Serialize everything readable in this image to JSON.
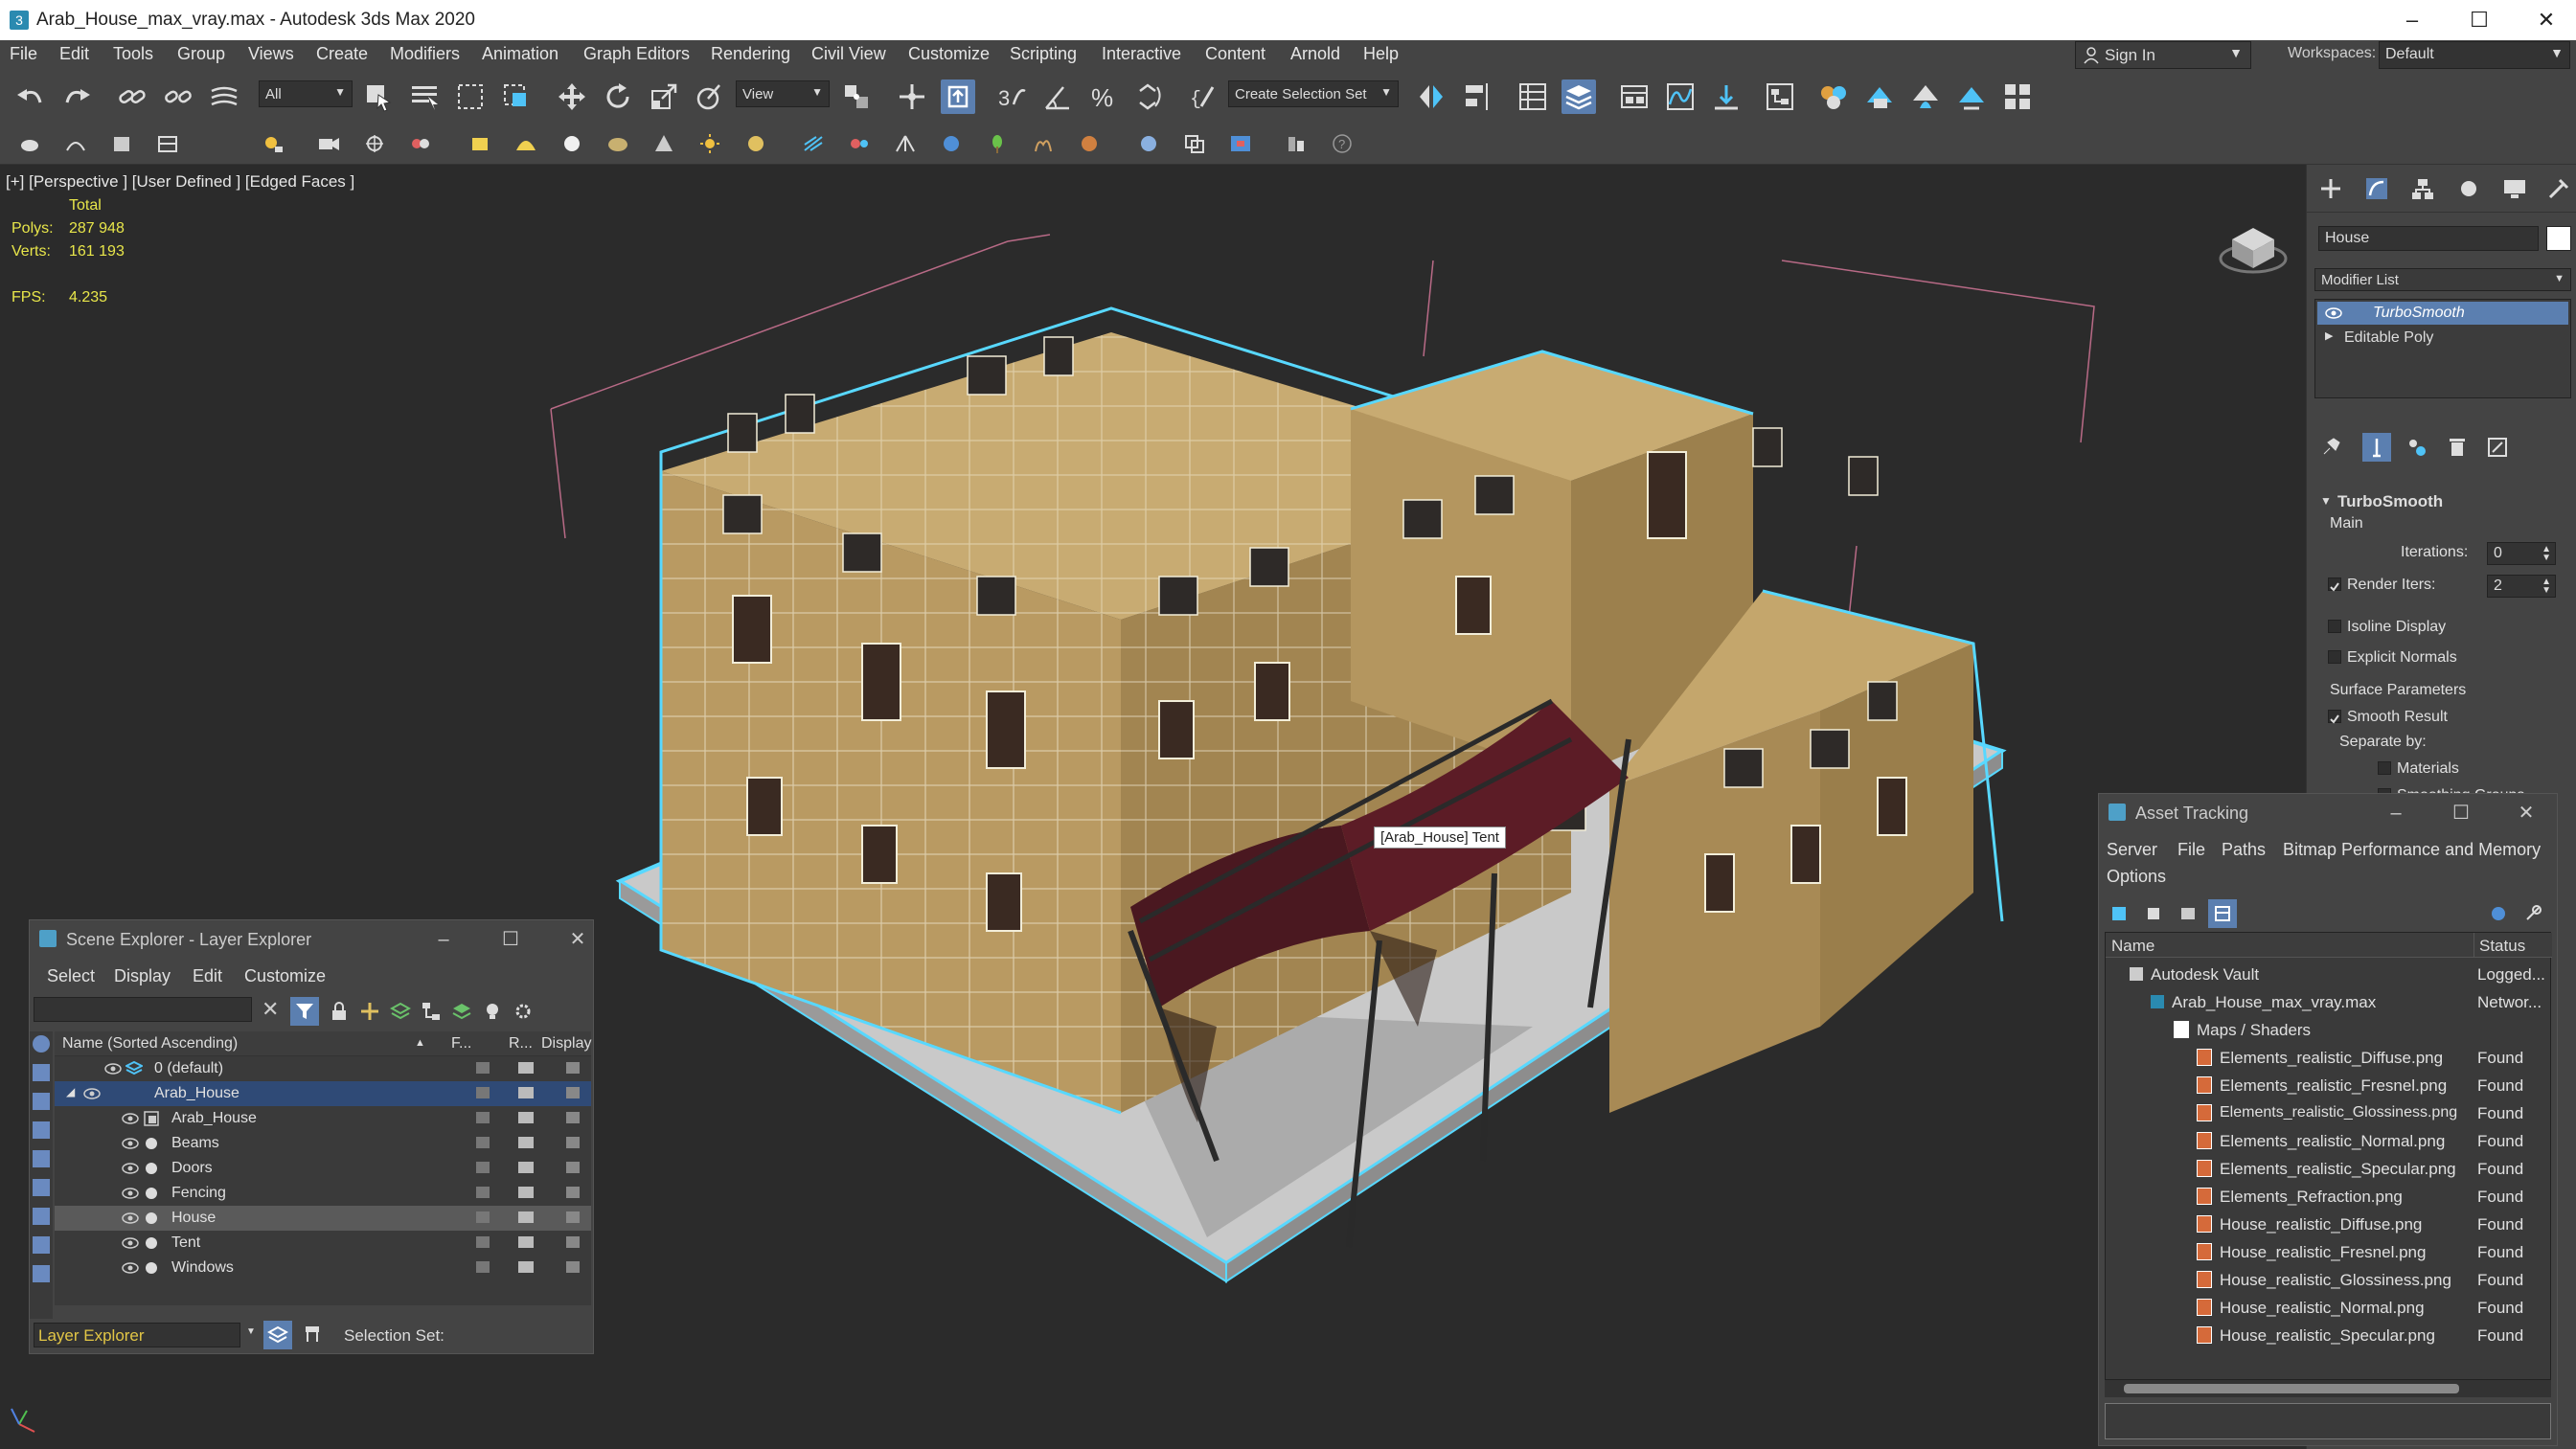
{
  "window": {
    "title": "Arab_House_max_vray.max - Autodesk 3ds Max 2020",
    "minimize": "–",
    "maximize": "☐",
    "close": "✕"
  },
  "menu": [
    "File",
    "Edit",
    "Tools",
    "Group",
    "Views",
    "Create",
    "Modifiers",
    "Animation",
    "Graph Editors",
    "Rendering",
    "Civil View",
    "Customize",
    "Scripting",
    "Interactive",
    "Content",
    "Arnold",
    "Help"
  ],
  "account": {
    "sign_in": "Sign In",
    "workspaces_label": "Workspaces:",
    "workspace": "Default"
  },
  "toolbar": {
    "selection_filter": "All",
    "ref_coord": "View",
    "selection_set": "Create Selection Set"
  },
  "viewport": {
    "label": "[+] [Perspective ] [User Defined ] [Edged Faces ]",
    "stats": {
      "total_label": "Total",
      "polys_label": "Polys:",
      "polys": "287 948",
      "verts_label": "Verts:",
      "verts": "161 193",
      "fps_label": "FPS:",
      "fps": "4.235"
    },
    "tooltip": "[Arab_House] Tent"
  },
  "command_panel": {
    "object_name": "House",
    "modifier_list": "Modifier List",
    "stack": [
      "TurboSmooth",
      "Editable Poly"
    ],
    "rollout_title": "TurboSmooth",
    "main_label": "Main",
    "iterations_label": "Iterations:",
    "iterations": "0",
    "render_iters_label": "Render Iters:",
    "render_iters": "2",
    "isoline_display": "Isoline Display",
    "explicit_normals": "Explicit Normals",
    "surface_params": "Surface Parameters",
    "smooth_result": "Smooth Result",
    "separate_by": "Separate by:",
    "materials": "Materials",
    "smoothing_groups": "Smoothing Groups"
  },
  "scene_explorer": {
    "title": "Scene Explorer - Layer Explorer",
    "menu": [
      "Select",
      "Display",
      "Edit",
      "Customize"
    ],
    "columns": {
      "name": "Name (Sorted Ascending)",
      "sort_arrow": "▲",
      "freeze": "F...",
      "render": "R...",
      "display": "Display ..."
    },
    "rows": [
      {
        "name": "0 (default)"
      },
      {
        "name": "Arab_House"
      },
      {
        "name": "Arab_House"
      },
      {
        "name": "Beams"
      },
      {
        "name": "Doors"
      },
      {
        "name": "Fencing"
      },
      {
        "name": "House"
      },
      {
        "name": "Tent"
      },
      {
        "name": "Windows"
      }
    ],
    "footer_explorer": "Layer Explorer",
    "selection_set_label": "Selection Set:"
  },
  "asset_tracking": {
    "title": "Asset Tracking",
    "menu": [
      "Server",
      "File",
      "Paths",
      "Bitmap Performance and Memory",
      "Options"
    ],
    "columns": {
      "name": "Name",
      "status": "Status"
    },
    "rows": [
      {
        "name": "Autodesk Vault",
        "status": "Logged..."
      },
      {
        "name": "Arab_House_max_vray.max",
        "status": "Networ..."
      },
      {
        "name": "Maps / Shaders",
        "status": ""
      },
      {
        "name": "Elements_realistic_Diffuse.png",
        "status": "Found"
      },
      {
        "name": "Elements_realistic_Fresnel.png",
        "status": "Found"
      },
      {
        "name": "Elements_realistic_Glossiness.png",
        "status": "Found"
      },
      {
        "name": "Elements_realistic_Normal.png",
        "status": "Found"
      },
      {
        "name": "Elements_realistic_Specular.png",
        "status": "Found"
      },
      {
        "name": "Elements_Refraction.png",
        "status": "Found"
      },
      {
        "name": "House_realistic_Diffuse.png",
        "status": "Found"
      },
      {
        "name": "House_realistic_Fresnel.png",
        "status": "Found"
      },
      {
        "name": "House_realistic_Glossiness.png",
        "status": "Found"
      },
      {
        "name": "House_realistic_Normal.png",
        "status": "Found"
      },
      {
        "name": "House_realistic_Specular.png",
        "status": "Found"
      }
    ]
  },
  "colors": {
    "accent": "#5b7fb0",
    "selection_outline": "#58d8ff",
    "stats_yellow": "#e8e64a",
    "explorer_footer_text": "#e2c646"
  }
}
